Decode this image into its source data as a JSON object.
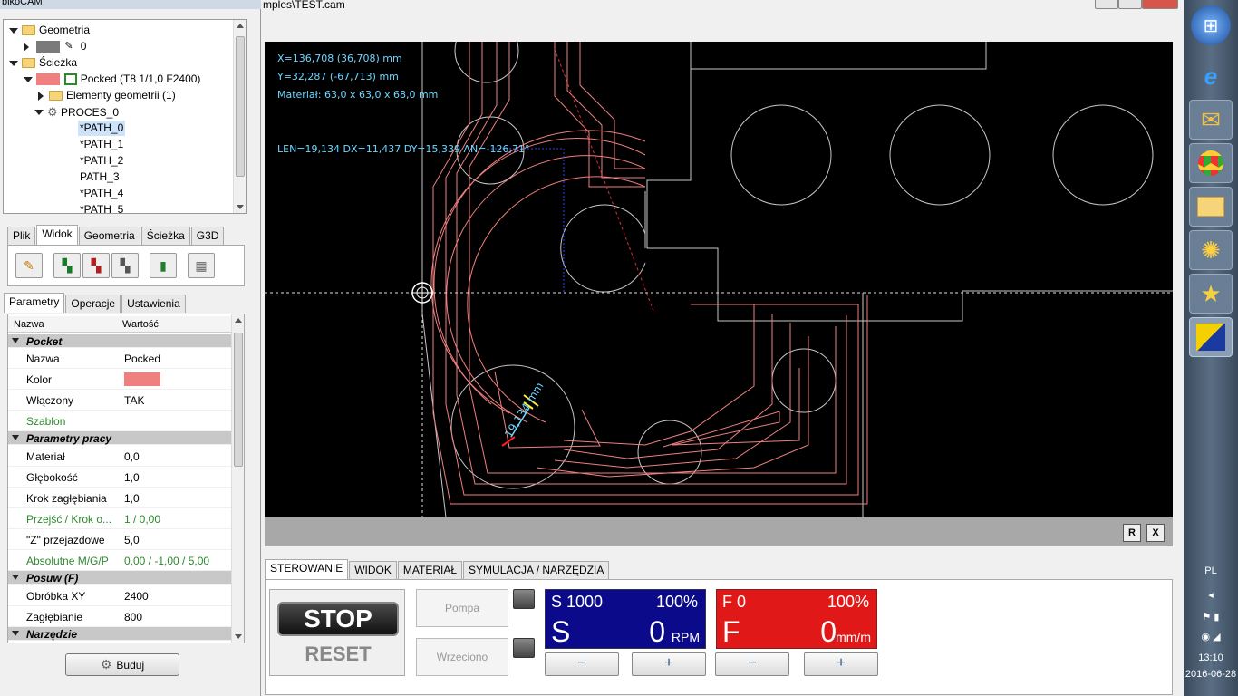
{
  "app": {
    "title": "bikoCAM",
    "window_title": "mples\\TEST.cam"
  },
  "tree": {
    "items": [
      {
        "label": "Geometria"
      },
      {
        "label": "0"
      },
      {
        "label": "Ścieżka"
      },
      {
        "label": "Pocked (T8 1/1,0 F2400)"
      },
      {
        "label": "Elementy geometrii (1)"
      },
      {
        "label": "PROCES_0"
      },
      {
        "label": "*PATH_0"
      },
      {
        "label": "*PATH_1"
      },
      {
        "label": "*PATH_2"
      },
      {
        "label": "PATH_3"
      },
      {
        "label": "*PATH_4"
      },
      {
        "label": "*PATH_5"
      }
    ]
  },
  "main_tabs": [
    "Plik",
    "Widok",
    "Geometria",
    "Ścieżka",
    "G3D"
  ],
  "main_tab_active": "Widok",
  "panel_tabs": [
    "Parametry",
    "Operacje",
    "Ustawienia"
  ],
  "panel_tab_active": "Parametry",
  "props": {
    "header_name": "Nazwa",
    "header_value": "Wartość",
    "sections": {
      "pocket": "Pocket",
      "work": "Parametry pracy",
      "feed": "Posuw (F)",
      "tool": "Narzędzie"
    },
    "rows": {
      "nazwa": {
        "name": "Nazwa",
        "value": "Pocked"
      },
      "kolor": {
        "name": "Kolor",
        "value_color": "#f08080"
      },
      "wlaczony": {
        "name": "Włączony",
        "value": "TAK"
      },
      "szablon": {
        "name": "Szablon",
        "value": ""
      },
      "material": {
        "name": "Materiał",
        "value": "0,0"
      },
      "glebokosc": {
        "name": "Głębokość",
        "value": "1,0"
      },
      "krok": {
        "name": "Krok zagłębiania",
        "value": "1,0"
      },
      "przejsc": {
        "name": "Przejść / Krok o...",
        "value": "1 / 0,00"
      },
      "zprzejazd": {
        "name": "\"Z\" przejazdowe",
        "value": "5,0"
      },
      "absolutne": {
        "name": "Absolutne M/G/P",
        "value": "0,00 / -1,00 / 5,00"
      },
      "obrobka": {
        "name": "Obróbka XY",
        "value": "2400"
      },
      "zaglebianie": {
        "name": "Zagłębianie",
        "value": "800"
      }
    }
  },
  "buduj_label": "Buduj",
  "hud": {
    "x": "X=136,708 (36,708) mm",
    "y": "Y=32,287 (-67,713) mm",
    "material": "Materiał: 63,0 x 63,0 x 68,0 mm",
    "measure": "LEN=19,134 DX=11,437 DY=15,339 AN=-126,71°",
    "dimension": "19,134 mm"
  },
  "viewport_buttons": {
    "r": "R",
    "x": "X"
  },
  "control_tabs": [
    "STEROWANIE",
    "WIDOK",
    "MATERIAŁ",
    "SYMULACJA / NARZĘDZIA"
  ],
  "control_tab_active": "STEROWANIE",
  "control": {
    "stop": "STOP",
    "reset": "RESET",
    "pompa": "Pompa",
    "wrzeciono": "Wrzeciono",
    "spindle": {
      "top": "S 1000",
      "pct": "100%",
      "letter": "S",
      "value": "0",
      "unit": "RPM",
      "color": "#0a0a8a"
    },
    "feed": {
      "top": "F 0",
      "pct": "100%",
      "letter": "F",
      "value": "0",
      "unit": "mm/m",
      "color": "#e01818"
    },
    "minus": "−",
    "plus": "+"
  },
  "tray": {
    "lang": "PL",
    "time": "13:10",
    "date": "2016-06-28"
  },
  "colors": {
    "path": "#f08080",
    "geometry": "#c8c8c8",
    "hud": "#6fd6ff"
  }
}
